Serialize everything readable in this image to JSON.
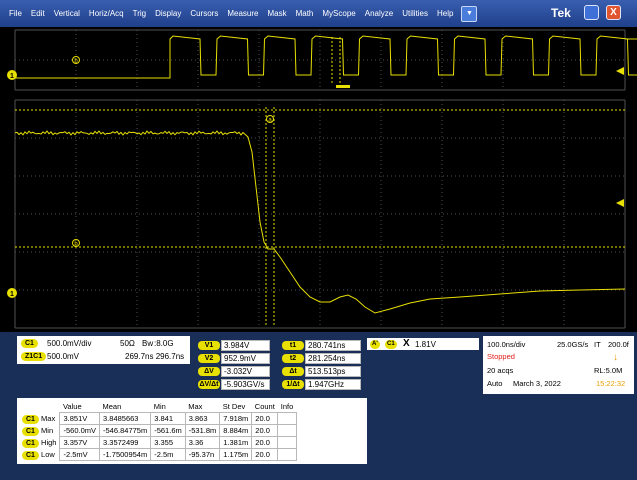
{
  "menu": [
    "File",
    "Edit",
    "Vertical",
    "Horiz/Acq",
    "Trig",
    "Display",
    "Cursors",
    "Measure",
    "Mask",
    "Math",
    "MyScope",
    "Analyze",
    "Utilities",
    "Help"
  ],
  "brand": "Tek",
  "window": {
    "close_label": "X"
  },
  "colors": {
    "trace": "#e8e000",
    "grid": "#505050",
    "background": "#000000",
    "panel_bg": "#1a2f58"
  },
  "channels": {
    "c1": {
      "tag": "C1",
      "scale": "500.0mV/div",
      "term": "50Ω",
      "bw_symbol": "Bw",
      "bw": ":8.0G"
    },
    "z1": {
      "tag": "Z1C1",
      "offset": "500.0mV",
      "range": "269.7ns 296.7ns"
    }
  },
  "cursors": {
    "v1_label": "V1",
    "v1": "3.984V",
    "v2_label": "V2",
    "v2": "952.9mV",
    "dv_label": "ΔV",
    "dv": "-3.032V",
    "dvdt_label": "ΔV/Δt",
    "dvdt": "-5.903GV/s",
    "t1_label": "t1",
    "t1": "280.741ns",
    "t2_label": "t2",
    "t2": "281.254ns",
    "dt_label": "Δt",
    "dt": "513.513ps",
    "inv_dt_label": "1/Δt",
    "inv_dt": "1.947GHz"
  },
  "trigger_readout": {
    "tag": "A'",
    "ch": "C1",
    "symbol": "X",
    "level": "1.81V"
  },
  "acquisition": {
    "timebase": "100.0ns/div",
    "rate": "25.0GS/s",
    "mode": "IT",
    "pts": "200.0f",
    "state": "Stopped",
    "acqs": "20 acqs",
    "rl": "RL:5.0M",
    "trigger": "Auto",
    "date": "March 3, 2022",
    "time": "15:22:32"
  },
  "stats": {
    "headers": [
      "",
      "Value",
      "Mean",
      "Min",
      "Max",
      "St Dev",
      "Count",
      "Info"
    ],
    "rows": [
      {
        "tag": "C1",
        "name": "Max",
        "value": "3.851V",
        "mean": "3.8485663",
        "min": "3.841",
        "max": "3.863",
        "stdev": "7.918m",
        "count": "20.0"
      },
      {
        "tag": "C1",
        "name": "Min",
        "value": "-560.0mV",
        "mean": "-546.84775m",
        "min": "-561.6m",
        "max": "-531.8m",
        "stdev": "8.884m",
        "count": "20.0"
      },
      {
        "tag": "C1",
        "name": "High",
        "value": "3.357V",
        "mean": "3.3572499",
        "min": "3.355",
        "max": "3.36",
        "stdev": "1.381m",
        "count": "20.0"
      },
      {
        "tag": "C1",
        "name": "Low",
        "value": "-2.5mV",
        "mean": "-1.7500954m",
        "min": "-2.5m",
        "max": "-95.37n",
        "stdev": "1.175m",
        "count": "20.0"
      }
    ]
  },
  "markers": {
    "ch1": "1",
    "cursor_a": "a",
    "cursor_b": "b"
  }
}
